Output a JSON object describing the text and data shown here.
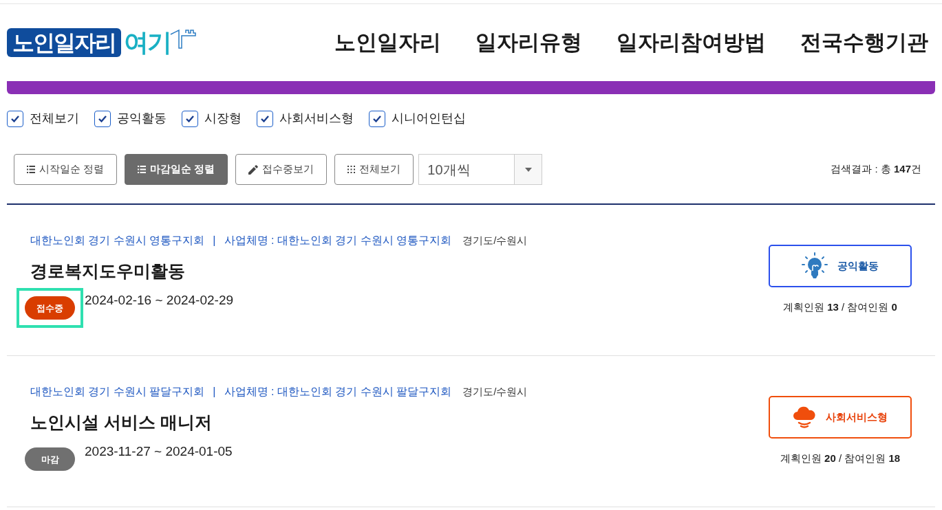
{
  "logo": {
    "main": "노인일자리",
    "accent": "여기"
  },
  "nav": [
    {
      "label": "노인일자리"
    },
    {
      "label": "일자리유형"
    },
    {
      "label": "일자리참여방법"
    },
    {
      "label": "전국수행기관"
    }
  ],
  "filters": [
    {
      "label": "전체보기",
      "checked": true
    },
    {
      "label": "공익활동",
      "checked": true
    },
    {
      "label": "시장형",
      "checked": true
    },
    {
      "label": "사회서비스형",
      "checked": true
    },
    {
      "label": "시니어인턴십",
      "checked": true
    }
  ],
  "toolbar": {
    "buttons": [
      {
        "label": "시작일순 정렬",
        "kind": "list",
        "selected": false
      },
      {
        "label": "마감일순 정렬",
        "kind": "list",
        "selected": true
      },
      {
        "label": "접수중보기",
        "kind": "pencil",
        "selected": false
      },
      {
        "label": "전체보기",
        "kind": "grid",
        "selected": false
      }
    ],
    "page_size": {
      "value": "10개씩"
    },
    "result": "검색결과 : 총 **147**건"
  },
  "jobs": [
    {
      "org": "대한노인회 경기 수원시 영통구지회",
      "separator": "|",
      "company": "사업체명 : 대한노인회 경기 수원시 영통구지회",
      "region": "경기도/수원시",
      "title": "경로복지도우미활동",
      "status": {
        "label": "접수중",
        "kind": "open",
        "focused": true
      },
      "period": "2024-02-16 ~ 2024-02-29",
      "category": {
        "label": "공익활동",
        "kind": "public"
      },
      "headcount": "계획인원 **13** / 참여인원 **0**"
    },
    {
      "org": "대한노인회 경기 수원시 팔달구지회",
      "separator": "|",
      "company": "사업체명 : 대한노인회 경기 수원시 팔달구지회",
      "region": "경기도/수원시",
      "title": "노인시설 서비스 매니저",
      "status": {
        "label": "마감",
        "kind": "closed",
        "focused": false
      },
      "period": "2023-11-27 ~ 2024-01-05",
      "category": {
        "label": "사회서비스형",
        "kind": "social"
      },
      "headcount": "계획인원 **20** / 참여인원 **18**"
    }
  ]
}
